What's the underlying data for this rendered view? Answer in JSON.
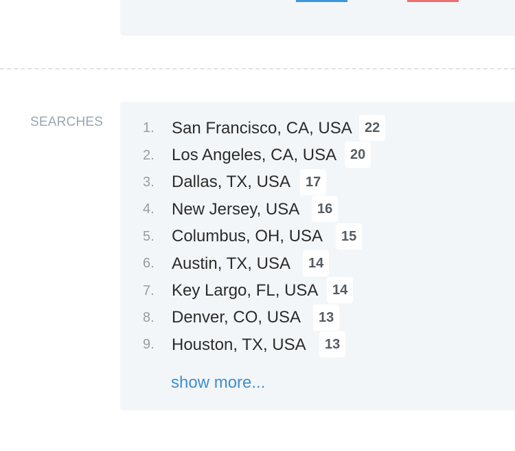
{
  "searches": {
    "label": "SEARCHES",
    "items": [
      {
        "rank": "1.",
        "location": "San Francisco, CA, USA",
        "count": "22"
      },
      {
        "rank": "2.",
        "location": "Los Angeles, CA, USA",
        "count": "20"
      },
      {
        "rank": "3.",
        "location": "Dallas, TX, USA",
        "count": "17"
      },
      {
        "rank": "4.",
        "location": "New Jersey, USA",
        "count": "16"
      },
      {
        "rank": "5.",
        "location": "Columbus, OH, USA",
        "count": "15"
      },
      {
        "rank": "6.",
        "location": "Austin, TX, USA",
        "count": "14"
      },
      {
        "rank": "7.",
        "location": "Key Largo, FL, USA",
        "count": "14"
      },
      {
        "rank": "8.",
        "location": "Denver, CO, USA",
        "count": "13"
      },
      {
        "rank": "9.",
        "location": "Houston, TX, USA",
        "count": "13"
      }
    ],
    "show_more_label": "show more..."
  },
  "colors": {
    "panel_bg": "#f3f6f9",
    "accent_blue": "#3e97dc",
    "accent_red": "#ef6f6f",
    "link": "#3e8ed0",
    "label_gray": "#9aa6b1"
  }
}
